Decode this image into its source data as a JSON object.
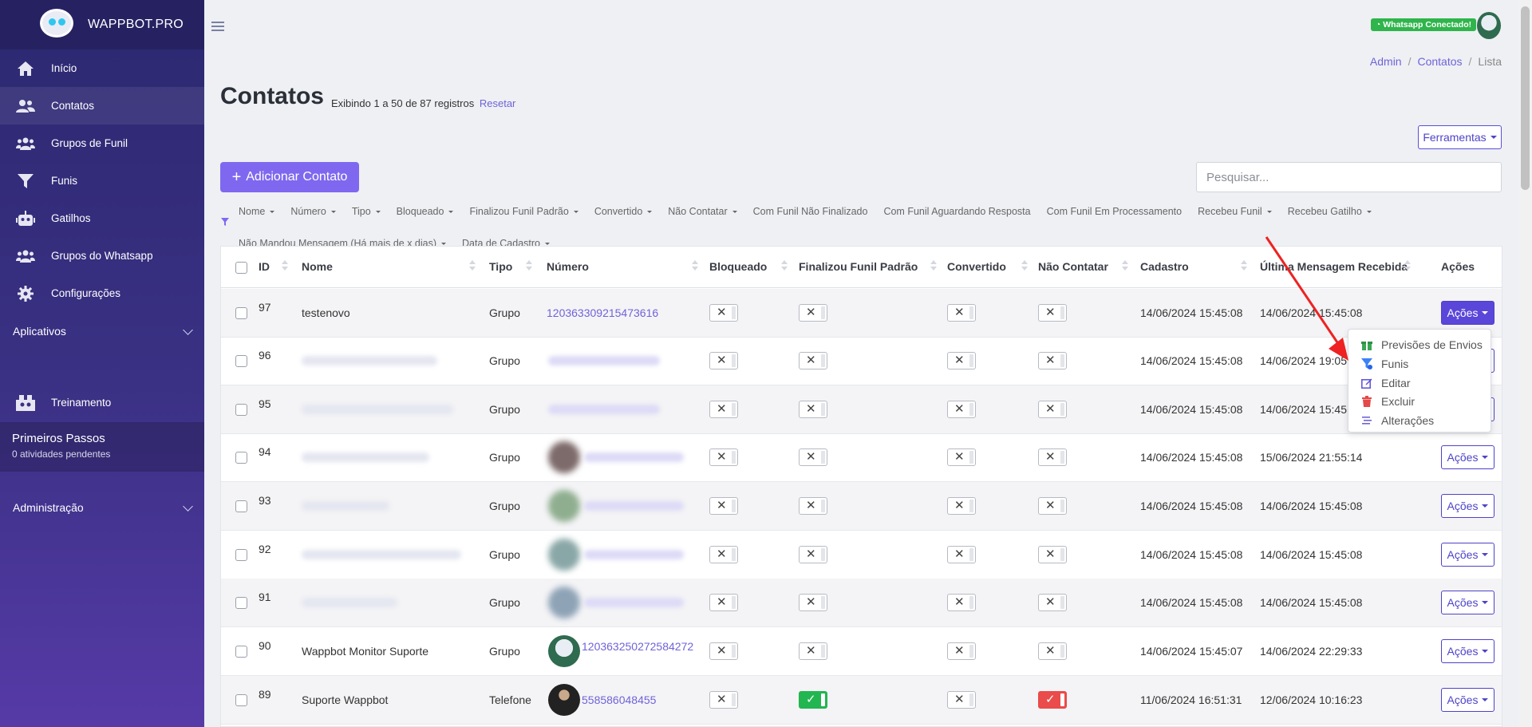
{
  "brand": {
    "name": "WAPPBOT.PRO"
  },
  "sidebar": {
    "items": [
      {
        "label": "Início",
        "icon": "home-icon"
      },
      {
        "label": "Contatos",
        "icon": "users-icon",
        "active": true
      },
      {
        "label": "Grupos de Funil",
        "icon": "user-group-icon"
      },
      {
        "label": "Funis",
        "icon": "filter-icon"
      },
      {
        "label": "Gatilhos",
        "icon": "robot-icon"
      },
      {
        "label": "Grupos do Whatsapp",
        "icon": "user-group-icon"
      },
      {
        "label": "Configurações",
        "icon": "gear-icon"
      }
    ],
    "aplicativos": "Aplicativos",
    "treinamento": "Treinamento",
    "primeiros_passos": {
      "title": "Primeiros Passos",
      "subtitle": "0 atividades pendentes"
    },
    "administracao": "Administração"
  },
  "topbar": {
    "whatsapp_status": "Whatsapp Conectado!"
  },
  "breadcrumb": [
    "Admin",
    "Contatos",
    "Lista"
  ],
  "header": {
    "title": "Contatos",
    "subtitle": "Exibindo 1 a 50 de 87 registros",
    "reset": "Resetar",
    "tools_button": "Ferramentas",
    "add_button": "Adicionar Contato",
    "search_placeholder": "Pesquisar..."
  },
  "filters": [
    {
      "label": "Nome",
      "dropdown": true
    },
    {
      "label": "Número",
      "dropdown": true
    },
    {
      "label": "Tipo",
      "dropdown": true
    },
    {
      "label": "Bloqueado",
      "dropdown": true
    },
    {
      "label": "Finalizou Funil Padrão",
      "dropdown": true
    },
    {
      "label": "Convertido",
      "dropdown": true
    },
    {
      "label": "Não Contatar",
      "dropdown": true
    },
    {
      "label": "Com Funil Não Finalizado",
      "dropdown": false
    },
    {
      "label": "Com Funil Aguardando Resposta",
      "dropdown": false
    },
    {
      "label": "Com Funil Em Processamento",
      "dropdown": false
    },
    {
      "label": "Recebeu Funil",
      "dropdown": true
    },
    {
      "label": "Recebeu Gatilho",
      "dropdown": true
    },
    {
      "label": "Não Mandou Mensagem (Há mais de x dias)",
      "dropdown": true
    },
    {
      "label": "Data de Cadastro",
      "dropdown": true
    }
  ],
  "table": {
    "columns": [
      "ID",
      "Nome",
      "Tipo",
      "Número",
      "Bloqueado",
      "Finalizou Funil Padrão",
      "Convertido",
      "Não Contatar",
      "Cadastro",
      "Última Mensagem Recebida",
      "Ações"
    ],
    "rows": [
      {
        "id": "97",
        "nome": "testenovo",
        "tipo": "Grupo",
        "numero": "120363309215473616",
        "bloqueado": "✕",
        "finalizou": "✕",
        "convertido": "✕",
        "nao_contatar": "✕",
        "cadastro": "14/06/2024 15:45:08",
        "ultima": "14/06/2024 15:45:08",
        "acoes": "Ações"
      },
      {
        "id": "96",
        "nome": "",
        "tipo": "Grupo",
        "numero": "",
        "bloqueado": "✕",
        "finalizou": "✕",
        "convertido": "✕",
        "nao_contatar": "✕",
        "cadastro": "14/06/2024 15:45:08",
        "ultima": "14/06/2024 19:05",
        "acoes": "Ações"
      },
      {
        "id": "95",
        "nome": "",
        "tipo": "Grupo",
        "numero": "",
        "bloqueado": "✕",
        "finalizou": "✕",
        "convertido": "✕",
        "nao_contatar": "✕",
        "cadastro": "14/06/2024 15:45:08",
        "ultima": "14/06/2024 15:45",
        "acoes": "Ações"
      },
      {
        "id": "94",
        "nome": "",
        "tipo": "Grupo",
        "numero": "",
        "bloqueado": "✕",
        "finalizou": "✕",
        "convertido": "✕",
        "nao_contatar": "✕",
        "cadastro": "14/06/2024 15:45:08",
        "ultima": "15/06/2024 21:55:14",
        "acoes": "Ações"
      },
      {
        "id": "93",
        "nome": "",
        "tipo": "Grupo",
        "numero": "",
        "bloqueado": "✕",
        "finalizou": "✕",
        "convertido": "✕",
        "nao_contatar": "✕",
        "cadastro": "14/06/2024 15:45:08",
        "ultima": "14/06/2024 15:45:08",
        "acoes": "Ações"
      },
      {
        "id": "92",
        "nome": "",
        "tipo": "Grupo",
        "numero": "",
        "bloqueado": "✕",
        "finalizou": "✕",
        "convertido": "✕",
        "nao_contatar": "✕",
        "cadastro": "14/06/2024 15:45:08",
        "ultima": "14/06/2024 15:45:08",
        "acoes": "Ações"
      },
      {
        "id": "91",
        "nome": "",
        "tipo": "Grupo",
        "numero": "",
        "bloqueado": "✕",
        "finalizou": "✕",
        "convertido": "✕",
        "nao_contatar": "✕",
        "cadastro": "14/06/2024 15:45:08",
        "ultima": "14/06/2024 15:45:08",
        "acoes": "Ações"
      },
      {
        "id": "90",
        "nome": "Wappbot Monitor Suporte",
        "tipo": "Grupo",
        "numero": "120363250272584272",
        "bloqueado": "✕",
        "finalizou": "✕",
        "convertido": "✕",
        "nao_contatar": "✕",
        "cadastro": "14/06/2024 15:45:07",
        "ultima": "14/06/2024 22:29:33",
        "acoes": "Ações"
      },
      {
        "id": "89",
        "nome": "Suporte Wappbot",
        "tipo": "Telefone",
        "numero": "558586048455",
        "bloqueado": "✕",
        "finalizou": "✓",
        "convertido": "✕",
        "nao_contatar": "✓",
        "cadastro": "11/06/2024 16:51:31",
        "ultima": "12/06/2024 10:16:23",
        "acoes": "Ações"
      }
    ]
  },
  "actions_menu": [
    {
      "label": "Previsões de Envios",
      "icon": "gift-icon",
      "color": "#3aa655"
    },
    {
      "label": "Funis",
      "icon": "funnel-icon",
      "color": "#3b82f6"
    },
    {
      "label": "Editar",
      "icon": "edit-icon",
      "color": "#5b4fd8"
    },
    {
      "label": "Excluir",
      "icon": "trash-icon",
      "color": "#e44848"
    },
    {
      "label": "Alterações",
      "icon": "list-icon",
      "color": "#6f63d8"
    }
  ],
  "colors": {
    "sidebar": "#2c2870",
    "accent": "#7f68ef",
    "link": "#6f63d8",
    "whatsapp": "#2fb54b",
    "toggle_on_green": "#22b650",
    "toggle_on_red": "#ea4b4b"
  }
}
